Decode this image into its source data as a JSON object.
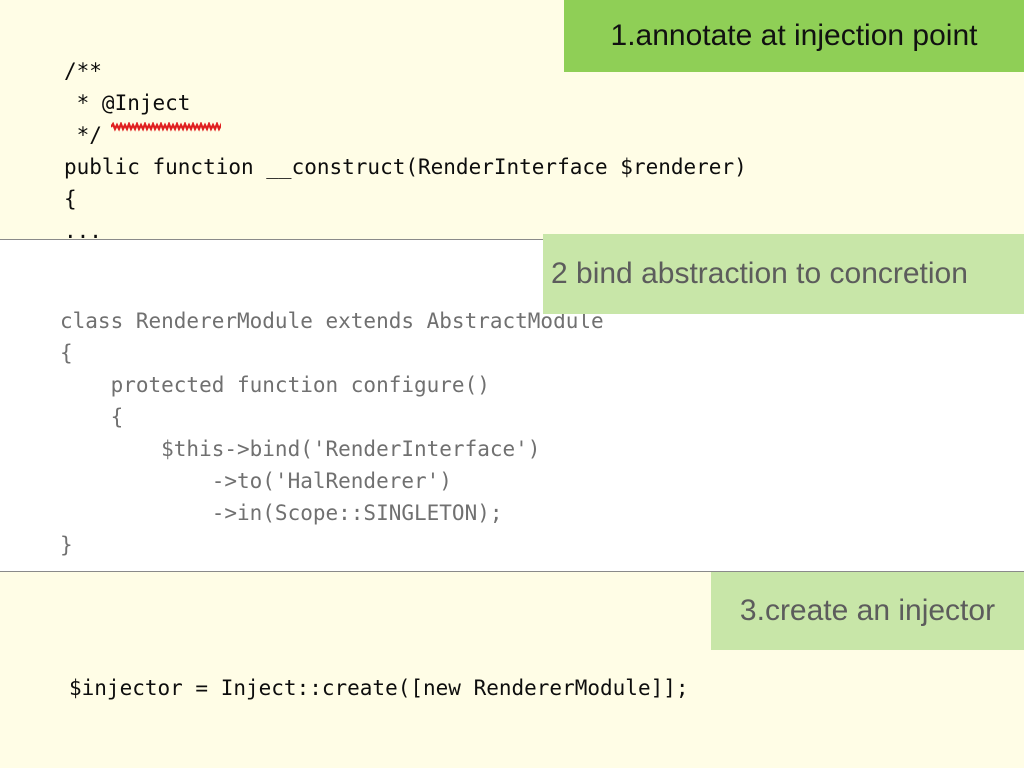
{
  "slide": {
    "step1": {
      "label": "1.annotate at injection point",
      "code_lines": [
        "/**",
        " * @Inject",
        " */",
        "public function __construct(RenderInterface $renderer)",
        "{",
        "..."
      ]
    },
    "step2": {
      "label": "2 bind abstraction to concretion",
      "code_lines": [
        "class RendererModule extends AbstractModule",
        "{",
        "    protected function configure()",
        "    {",
        "        $this->bind('RenderInterface')",
        "            ->to('HalRenderer')",
        "            ->in(Scope::SINGLETON);",
        "}"
      ]
    },
    "step3": {
      "label": "3.create an injector",
      "code_lines": [
        "$injector = Inject::create([new RendererModule]];"
      ]
    }
  },
  "colors": {
    "section_bg": "#fffde6",
    "tag1_bg": "#8fcf56",
    "tag_light_bg": "#c8e6a8",
    "annotation_underline": "#e02020"
  }
}
